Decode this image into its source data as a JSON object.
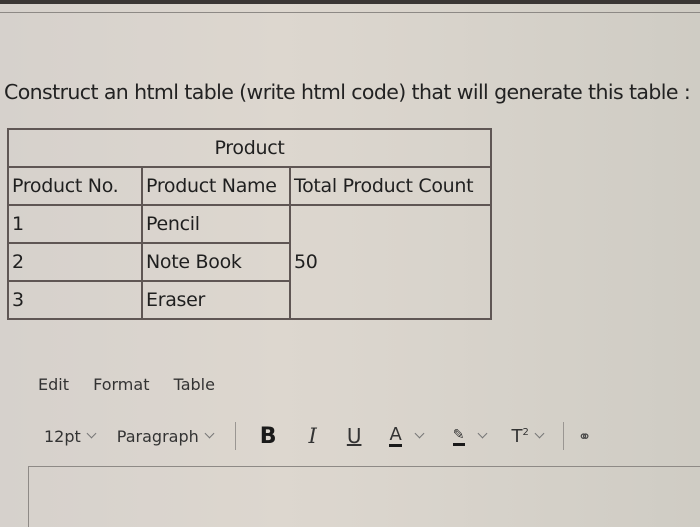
{
  "question": "Construct an html table (write html code) that will generate this table :",
  "table": {
    "caption": "Product",
    "headers": [
      "Product No.",
      "Product Name",
      "Total Product Count"
    ],
    "rows": [
      {
        "no": "1",
        "name": "Pencil"
      },
      {
        "no": "2",
        "name": "Note Book"
      },
      {
        "no": "3",
        "name": "Eraser"
      }
    ],
    "total_count": "50"
  },
  "editor": {
    "menu": [
      "Edit",
      "Format",
      "Table"
    ],
    "font_size": "12pt",
    "block_format": "Paragraph",
    "icons": {
      "bold": "B",
      "italic": "I",
      "underline": "U",
      "text_color": "A",
      "highlight": "✎",
      "superscript": "T",
      "superscript_mark": "2",
      "link": "⚭"
    },
    "content": ""
  }
}
